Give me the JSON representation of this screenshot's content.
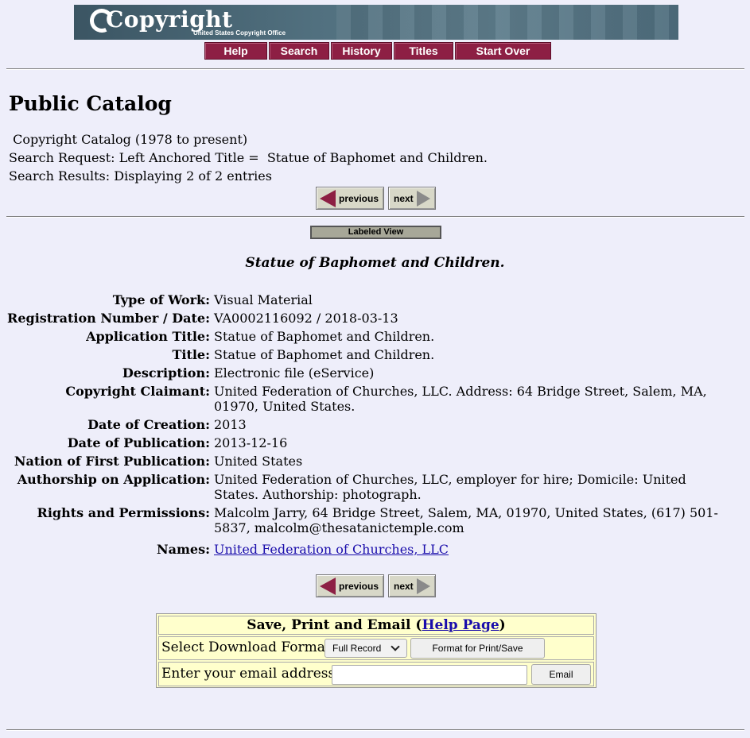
{
  "banner": {
    "logo_text": "Copyright",
    "logo_subtitle": "United States Copyright Office"
  },
  "nav": [
    "Help",
    "Search",
    "History",
    "Titles",
    "Start Over"
  ],
  "page_title": "Public Catalog",
  "catalog": " Copyright Catalog (1978 to present)",
  "search_request": "Search Request: Left Anchored Title =  Statue of Baphomet and Children.",
  "search_results": "Search Results: Displaying 2 of 2 entries",
  "pager": {
    "previous": "previous",
    "next": "next"
  },
  "labeled_view": "Labeled View",
  "record": {
    "heading": "Statue of Baphomet and Children.",
    "fields": [
      {
        "label": "Type of Work:",
        "value": "Visual Material"
      },
      {
        "label": "Registration Number / Date:",
        "value": "VA0002116092 / 2018-03-13"
      },
      {
        "label": "Application Title:",
        "value": "Statue of Baphomet and Children."
      },
      {
        "label": "Title:",
        "value": "Statue of Baphomet and Children."
      },
      {
        "label": "Description:",
        "value": "Electronic file (eService)"
      },
      {
        "label": "Copyright Claimant:",
        "value": "United Federation of Churches, LLC. Address: 64 Bridge Street, Salem, MA, 01970, United States."
      },
      {
        "label": "Date of Creation:",
        "value": "2013"
      },
      {
        "label": "Date of Publication:",
        "value": "2013-12-16"
      },
      {
        "label": "Nation of First Publication:",
        "value": "United States"
      },
      {
        "label": "Authorship on Application:",
        "value": "United Federation of Churches, LLC, employer for hire; Domicile: United States. Authorship: photograph."
      },
      {
        "label": "Rights and Permissions:",
        "value": "Malcolm Jarry, 64 Bridge Street, Salem, MA, 01970, United States, (617) 501-5837, malcolm@thesatanictemple.com"
      },
      {
        "label": "Names:",
        "value": "United Federation of Churches, LLC"
      }
    ]
  },
  "save_print_email": {
    "title_prefix": "Save, Print and Email (",
    "help_link": "Help Page",
    "title_suffix": ")",
    "download_label": "Select Download Format",
    "format_selected": "Full Record",
    "format_button": "Format for Print/Save",
    "email_label": "Enter your email address:",
    "email_value": "",
    "email_button": "Email"
  },
  "colors": {
    "background": "#eeeefa",
    "nav_button": "#8d1f44",
    "link": "#1a0dab",
    "form_bg": "#ffffcc"
  }
}
